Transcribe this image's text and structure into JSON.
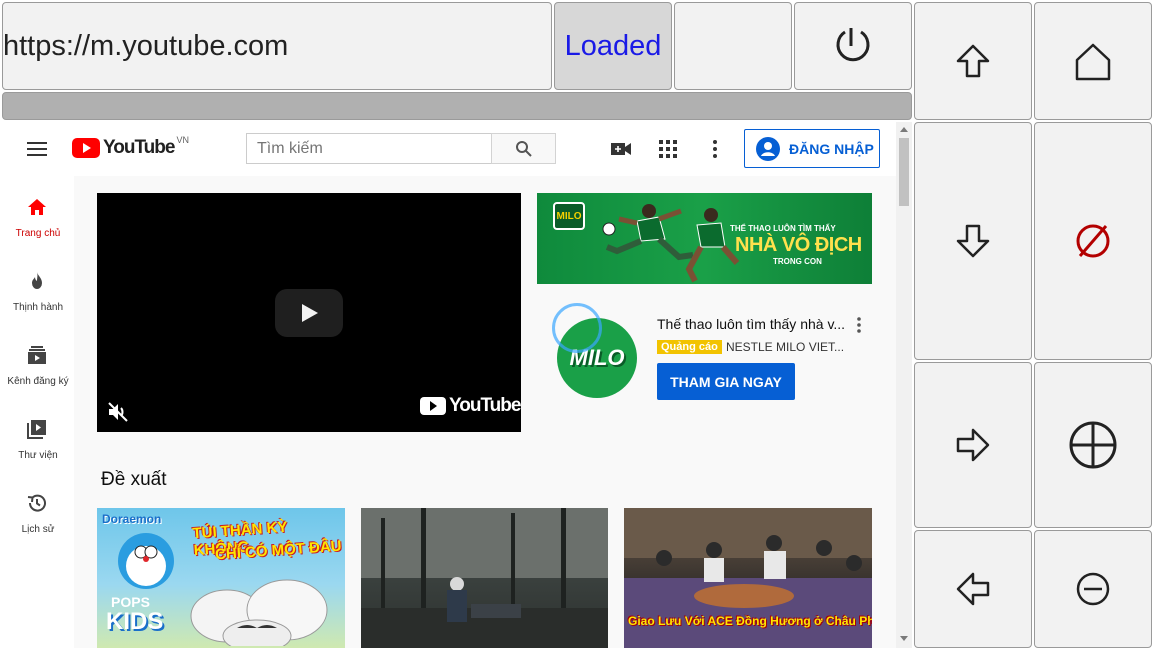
{
  "browser": {
    "url": "https://m.youtube.com",
    "status": "Loaded"
  },
  "header": {
    "logo_text": "YouTube",
    "region": "VN",
    "search_placeholder": "Tìm kiếm",
    "signin_label": "ĐĂNG NHẬP"
  },
  "nav": {
    "items": [
      {
        "label": "Trang chủ",
        "icon": "home-icon"
      },
      {
        "label": "Thịnh hành",
        "icon": "trending-icon"
      },
      {
        "label": "Kênh đăng ký",
        "icon": "subscriptions-icon"
      },
      {
        "label": "Thư viện",
        "icon": "library-icon"
      },
      {
        "label": "Lịch sử",
        "icon": "history-icon"
      }
    ]
  },
  "player": {
    "logo_text": "YouTube"
  },
  "banner": {
    "brand": "MILO",
    "line1": "THỂ THAO LUÔN TÌM THẤY",
    "line2": "NHÀ VÔ ĐỊCH",
    "line3": "TRONG CON"
  },
  "ad": {
    "logo_text": "MILO",
    "title": "Thế thao luôn tìm thấy nhà v...",
    "badge": "Quảng cáo",
    "advertiser": "NESTLE MILO VIET...",
    "cta": "THAM GIA NGAY"
  },
  "feed": {
    "section_title": "Đề xuất",
    "thumb1": {
      "brand": "Doraemon",
      "title_line1": "TÚI THẦN KỲ KHÔNG",
      "title_line2": "CHỈ CÓ MỘT ĐÂU",
      "channel_line1": "POPS",
      "channel_line2": "KIDS"
    },
    "thumb3": {
      "caption": "Giao Lưu Với ACE Đồng Hương ở Châu Phi"
    }
  },
  "colors": {
    "yt_red": "#ff0000",
    "link_blue": "#065fd4",
    "ad_badge": "#f2c300",
    "status_text": "#1a1ae6",
    "cancel_red": "#b30000"
  }
}
